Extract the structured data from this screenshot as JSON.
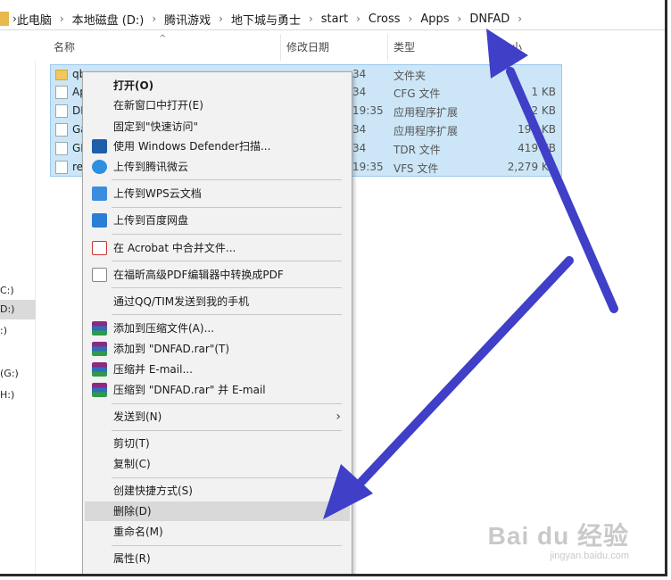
{
  "breadcrumb": [
    "此电脑",
    "本地磁盘 (D:)",
    "腾讯游戏",
    "地下城与勇士",
    "start",
    "Cross",
    "Apps",
    "DNFAD"
  ],
  "columns": {
    "name": "名称",
    "date": "修改日期",
    "type": "类型",
    "size": "大小"
  },
  "nav": [
    "C:)",
    "D:)",
    ":)",
    "(G:)",
    "H:)"
  ],
  "files": [
    {
      "icon": "folder",
      "name": "qb",
      "date": "34",
      "type": "文件夹",
      "size": ""
    },
    {
      "icon": "file",
      "name": "Ap",
      "date": "34",
      "type": "CFG 文件",
      "size": "1 KB"
    },
    {
      "icon": "dll",
      "name": "DN",
      "date": "19:35",
      "type": "应用程序扩展",
      "size": "32 KB"
    },
    {
      "icon": "dll",
      "name": "Ga",
      "date": "34",
      "type": "应用程序扩展",
      "size": "197 KB"
    },
    {
      "icon": "file",
      "name": "GL",
      "date": "34",
      "type": "TDR 文件",
      "size": "419 KB"
    },
    {
      "icon": "file",
      "name": "re",
      "date": "19:35",
      "type": "VFS 文件",
      "size": "2,279 KB"
    }
  ],
  "menu": {
    "open": "打开(O)",
    "open_new_window": "在新窗口中打开(E)",
    "pin_quick_access": "固定到\"快速访问\"",
    "defender_scan": "使用 Windows Defender扫描...",
    "upload_tencent": "上传到腾讯微云",
    "upload_wps": "上传到WPS云文档",
    "upload_baidu": "上传到百度网盘",
    "acrobat_combine": "在 Acrobat 中合并文件...",
    "foxit_convert": "在福昕高级PDF编辑器中转换成PDF",
    "send_qq": "通过QQ/TIM发送到我的手机",
    "add_archive": "添加到压缩文件(A)...",
    "add_rar": "添加到 \"DNFAD.rar\"(T)",
    "compress_email": "压缩并 E-mail...",
    "compress_rar_email": "压缩到 \"DNFAD.rar\" 并 E-mail",
    "send_to": "发送到(N)",
    "cut": "剪切(T)",
    "copy": "复制(C)",
    "create_shortcut": "创建快捷方式(S)",
    "delete": "删除(D)",
    "rename": "重命名(M)",
    "properties": "属性(R)"
  },
  "annotation_color": "#3f3fc8",
  "watermark": {
    "main": "Bai du 经验",
    "sub": "jingyan.baidu.com"
  }
}
